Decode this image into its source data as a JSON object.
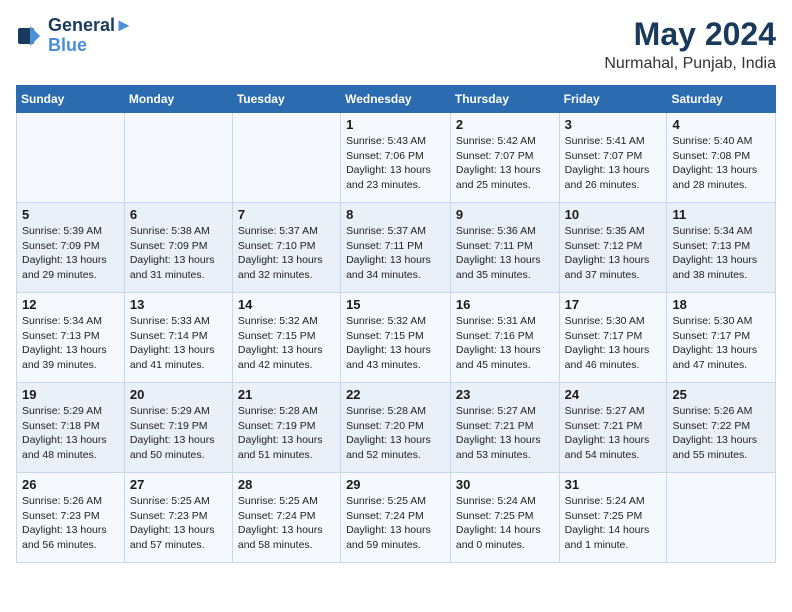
{
  "logo": {
    "line1": "General",
    "line2": "Blue"
  },
  "title": {
    "month_year": "May 2024",
    "location": "Nurmahal, Punjab, India"
  },
  "days_of_week": [
    "Sunday",
    "Monday",
    "Tuesday",
    "Wednesday",
    "Thursday",
    "Friday",
    "Saturday"
  ],
  "weeks": [
    [
      {
        "day": "",
        "sunrise": "",
        "sunset": "",
        "daylight": ""
      },
      {
        "day": "",
        "sunrise": "",
        "sunset": "",
        "daylight": ""
      },
      {
        "day": "",
        "sunrise": "",
        "sunset": "",
        "daylight": ""
      },
      {
        "day": "1",
        "sunrise": "Sunrise: 5:43 AM",
        "sunset": "Sunset: 7:06 PM",
        "daylight": "Daylight: 13 hours and 23 minutes."
      },
      {
        "day": "2",
        "sunrise": "Sunrise: 5:42 AM",
        "sunset": "Sunset: 7:07 PM",
        "daylight": "Daylight: 13 hours and 25 minutes."
      },
      {
        "day": "3",
        "sunrise": "Sunrise: 5:41 AM",
        "sunset": "Sunset: 7:07 PM",
        "daylight": "Daylight: 13 hours and 26 minutes."
      },
      {
        "day": "4",
        "sunrise": "Sunrise: 5:40 AM",
        "sunset": "Sunset: 7:08 PM",
        "daylight": "Daylight: 13 hours and 28 minutes."
      }
    ],
    [
      {
        "day": "5",
        "sunrise": "Sunrise: 5:39 AM",
        "sunset": "Sunset: 7:09 PM",
        "daylight": "Daylight: 13 hours and 29 minutes."
      },
      {
        "day": "6",
        "sunrise": "Sunrise: 5:38 AM",
        "sunset": "Sunset: 7:09 PM",
        "daylight": "Daylight: 13 hours and 31 minutes."
      },
      {
        "day": "7",
        "sunrise": "Sunrise: 5:37 AM",
        "sunset": "Sunset: 7:10 PM",
        "daylight": "Daylight: 13 hours and 32 minutes."
      },
      {
        "day": "8",
        "sunrise": "Sunrise: 5:37 AM",
        "sunset": "Sunset: 7:11 PM",
        "daylight": "Daylight: 13 hours and 34 minutes."
      },
      {
        "day": "9",
        "sunrise": "Sunrise: 5:36 AM",
        "sunset": "Sunset: 7:11 PM",
        "daylight": "Daylight: 13 hours and 35 minutes."
      },
      {
        "day": "10",
        "sunrise": "Sunrise: 5:35 AM",
        "sunset": "Sunset: 7:12 PM",
        "daylight": "Daylight: 13 hours and 37 minutes."
      },
      {
        "day": "11",
        "sunrise": "Sunrise: 5:34 AM",
        "sunset": "Sunset: 7:13 PM",
        "daylight": "Daylight: 13 hours and 38 minutes."
      }
    ],
    [
      {
        "day": "12",
        "sunrise": "Sunrise: 5:34 AM",
        "sunset": "Sunset: 7:13 PM",
        "daylight": "Daylight: 13 hours and 39 minutes."
      },
      {
        "day": "13",
        "sunrise": "Sunrise: 5:33 AM",
        "sunset": "Sunset: 7:14 PM",
        "daylight": "Daylight: 13 hours and 41 minutes."
      },
      {
        "day": "14",
        "sunrise": "Sunrise: 5:32 AM",
        "sunset": "Sunset: 7:15 PM",
        "daylight": "Daylight: 13 hours and 42 minutes."
      },
      {
        "day": "15",
        "sunrise": "Sunrise: 5:32 AM",
        "sunset": "Sunset: 7:15 PM",
        "daylight": "Daylight: 13 hours and 43 minutes."
      },
      {
        "day": "16",
        "sunrise": "Sunrise: 5:31 AM",
        "sunset": "Sunset: 7:16 PM",
        "daylight": "Daylight: 13 hours and 45 minutes."
      },
      {
        "day": "17",
        "sunrise": "Sunrise: 5:30 AM",
        "sunset": "Sunset: 7:17 PM",
        "daylight": "Daylight: 13 hours and 46 minutes."
      },
      {
        "day": "18",
        "sunrise": "Sunrise: 5:30 AM",
        "sunset": "Sunset: 7:17 PM",
        "daylight": "Daylight: 13 hours and 47 minutes."
      }
    ],
    [
      {
        "day": "19",
        "sunrise": "Sunrise: 5:29 AM",
        "sunset": "Sunset: 7:18 PM",
        "daylight": "Daylight: 13 hours and 48 minutes."
      },
      {
        "day": "20",
        "sunrise": "Sunrise: 5:29 AM",
        "sunset": "Sunset: 7:19 PM",
        "daylight": "Daylight: 13 hours and 50 minutes."
      },
      {
        "day": "21",
        "sunrise": "Sunrise: 5:28 AM",
        "sunset": "Sunset: 7:19 PM",
        "daylight": "Daylight: 13 hours and 51 minutes."
      },
      {
        "day": "22",
        "sunrise": "Sunrise: 5:28 AM",
        "sunset": "Sunset: 7:20 PM",
        "daylight": "Daylight: 13 hours and 52 minutes."
      },
      {
        "day": "23",
        "sunrise": "Sunrise: 5:27 AM",
        "sunset": "Sunset: 7:21 PM",
        "daylight": "Daylight: 13 hours and 53 minutes."
      },
      {
        "day": "24",
        "sunrise": "Sunrise: 5:27 AM",
        "sunset": "Sunset: 7:21 PM",
        "daylight": "Daylight: 13 hours and 54 minutes."
      },
      {
        "day": "25",
        "sunrise": "Sunrise: 5:26 AM",
        "sunset": "Sunset: 7:22 PM",
        "daylight": "Daylight: 13 hours and 55 minutes."
      }
    ],
    [
      {
        "day": "26",
        "sunrise": "Sunrise: 5:26 AM",
        "sunset": "Sunset: 7:23 PM",
        "daylight": "Daylight: 13 hours and 56 minutes."
      },
      {
        "day": "27",
        "sunrise": "Sunrise: 5:25 AM",
        "sunset": "Sunset: 7:23 PM",
        "daylight": "Daylight: 13 hours and 57 minutes."
      },
      {
        "day": "28",
        "sunrise": "Sunrise: 5:25 AM",
        "sunset": "Sunset: 7:24 PM",
        "daylight": "Daylight: 13 hours and 58 minutes."
      },
      {
        "day": "29",
        "sunrise": "Sunrise: 5:25 AM",
        "sunset": "Sunset: 7:24 PM",
        "daylight": "Daylight: 13 hours and 59 minutes."
      },
      {
        "day": "30",
        "sunrise": "Sunrise: 5:24 AM",
        "sunset": "Sunset: 7:25 PM",
        "daylight": "Daylight: 14 hours and 0 minutes."
      },
      {
        "day": "31",
        "sunrise": "Sunrise: 5:24 AM",
        "sunset": "Sunset: 7:25 PM",
        "daylight": "Daylight: 14 hours and 1 minute."
      },
      {
        "day": "",
        "sunrise": "",
        "sunset": "",
        "daylight": ""
      }
    ]
  ]
}
